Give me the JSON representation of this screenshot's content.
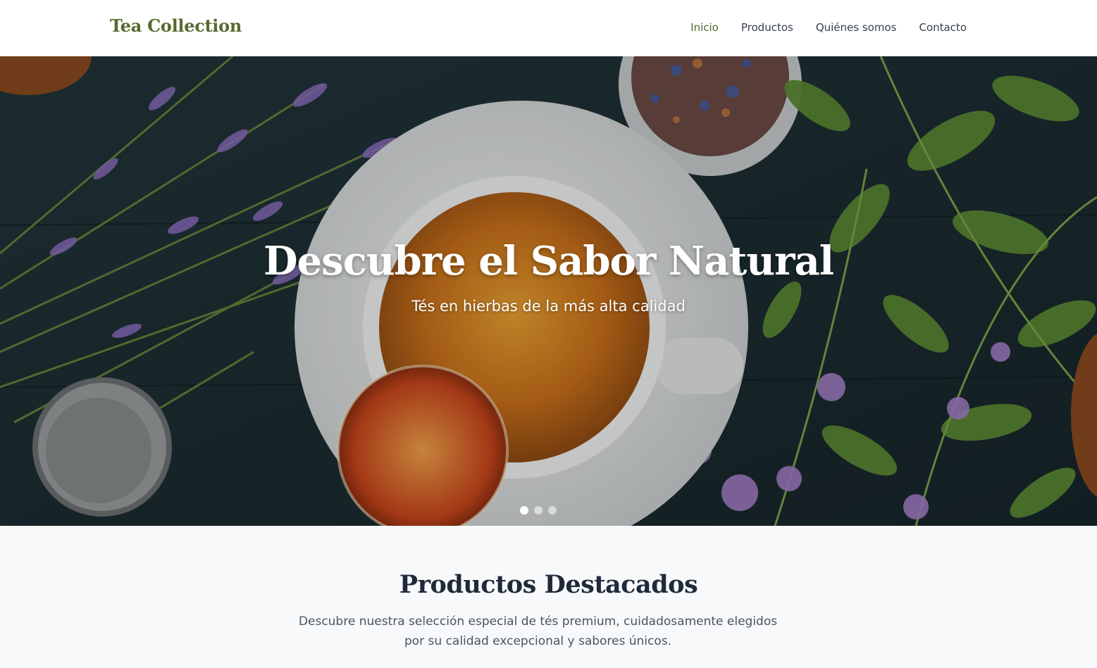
{
  "header": {
    "brand": "Tea Collection",
    "nav": [
      {
        "label": "Inicio",
        "active": true
      },
      {
        "label": "Productos",
        "active": false
      },
      {
        "label": "Quiénes somos",
        "active": false
      },
      {
        "label": "Contacto",
        "active": false
      }
    ]
  },
  "hero": {
    "title": "Descubre el Sabor Natural",
    "subtitle": "Tés en hierbas de la más alta calidad",
    "slides_total": 3,
    "active_slide": 1
  },
  "featured": {
    "title": "Productos Destacados",
    "description": "Descubre nuestra selección especial de tés premium, cuidadosamente elegidos por su calidad excepcional y sabores únicos."
  },
  "colors": {
    "brand": "#556b2f",
    "text_dark": "#1e2a3a",
    "text_muted": "#4b5563",
    "section_bg": "#f8f9fa"
  }
}
